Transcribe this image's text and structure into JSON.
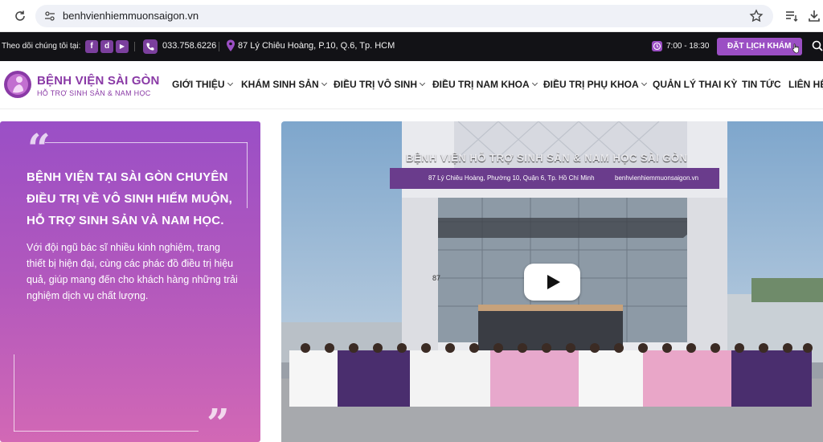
{
  "browser": {
    "url": "benhvienhiemmuonsaigon.vn"
  },
  "topbar": {
    "follow_label": "Theo dõi chúng tôi tại:",
    "social": [
      "f",
      "d",
      "▶"
    ],
    "phone": "033.758.6226",
    "address": "87 Lý Chiêu Hoàng, P.10, Q.6, Tp. HCM",
    "hours": "7:00 - 18:30",
    "book_label": "ĐẶT LỊCH KHÁM"
  },
  "logo": {
    "title": "BỆNH VIỆN SÀI GÒN",
    "subtitle": "HỖ TRỢ SINH SẢN & NAM HỌC"
  },
  "nav": {
    "items": [
      {
        "label": "GIỚI THIỆU",
        "has_dropdown": true
      },
      {
        "label": "KHÁM SINH SẢN",
        "has_dropdown": true
      },
      {
        "label": "ĐIỀU TRỊ VÔ SINH",
        "has_dropdown": true
      },
      {
        "label": "ĐIỀU TRỊ NAM KHOA",
        "has_dropdown": true
      },
      {
        "label": "ĐIỀU TRỊ PHỤ KHOA",
        "has_dropdown": true
      },
      {
        "label": "QUẢN LÝ THAI KỲ",
        "has_dropdown": false
      },
      {
        "label": "TIN TỨC",
        "has_dropdown": false
      },
      {
        "label": "LIÊN HỆ",
        "has_dropdown": false
      }
    ]
  },
  "card": {
    "quote_open": "“",
    "quote_close": "”",
    "heading": "BỆNH VIỆN TẠI SÀI GÒN CHUYÊN ĐIỀU TRỊ VỀ VÔ SINH HIẾM MUỘN, HỖ TRỢ SINH SẢN VÀ NAM HỌC.",
    "body": "Với đội ngũ bác sĩ nhiều kinh nghiệm, trang thiết bị hiện đại, cùng các phác đồ điều trị hiệu quả, giúp mang đến cho khách hàng những trải nghiệm dịch vụ chất lượng."
  },
  "hero": {
    "sign": "BỆNH VIỆN HỖ TRỢ SINH SẢN & NAM HỌC SÀI GÒN",
    "banner_address": "87 Lý Chiêu Hoàng, Phường 10, Quận 6, Tp. Hồ Chí Minh",
    "banner_web": "benhvienhiemmuonsaigon.vn",
    "building_number": "87"
  },
  "colors": {
    "brand_purple": "#8a3aa6",
    "button_purple": "#9b4fc4",
    "topbar_dark": "#121216"
  }
}
